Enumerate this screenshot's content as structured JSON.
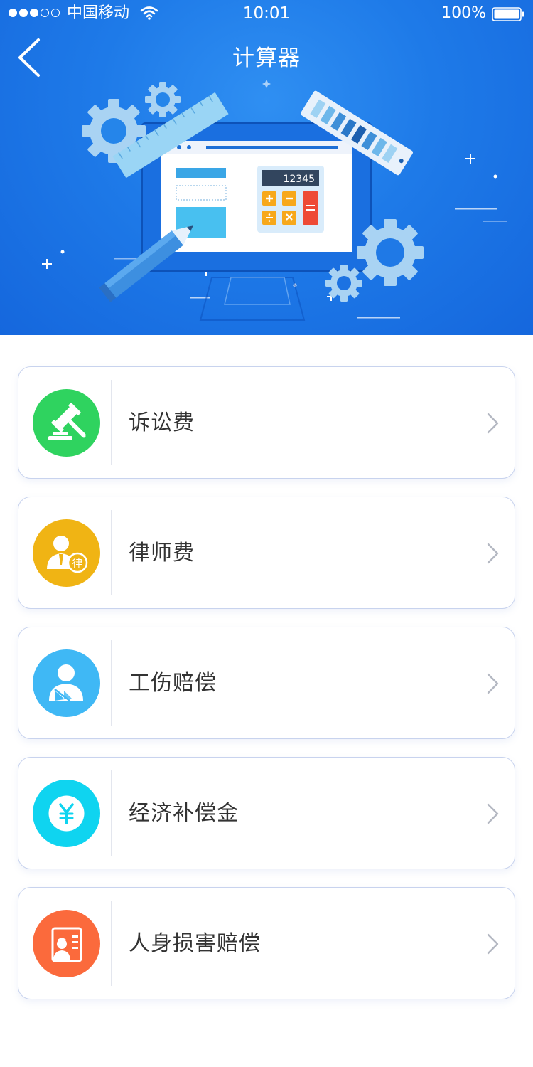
{
  "status_bar": {
    "carrier": "中国移动",
    "time": "10:01",
    "battery": "100%"
  },
  "header": {
    "title": "计算器",
    "back_icon": "chevron-left-icon"
  },
  "illustration": {
    "calculator_display": "12345"
  },
  "menu": {
    "items": [
      {
        "label": "诉讼费",
        "icon": "gavel-icon",
        "color": "#2fd35f"
      },
      {
        "label": "律师费",
        "icon": "lawyer-icon",
        "color": "#f0b414"
      },
      {
        "label": "工伤赔偿",
        "icon": "injured-person-icon",
        "color": "#3fb8f5"
      },
      {
        "label": "经济补偿金",
        "icon": "yuan-coin-icon",
        "color": "#0fd4f0"
      },
      {
        "label": "人身损害赔偿",
        "icon": "personal-injury-document-icon",
        "color": "#fb6a3c"
      }
    ]
  },
  "colors": {
    "header_bg": "#1e7ae8",
    "card_border": "#c8d3ee",
    "text": "#333333"
  }
}
